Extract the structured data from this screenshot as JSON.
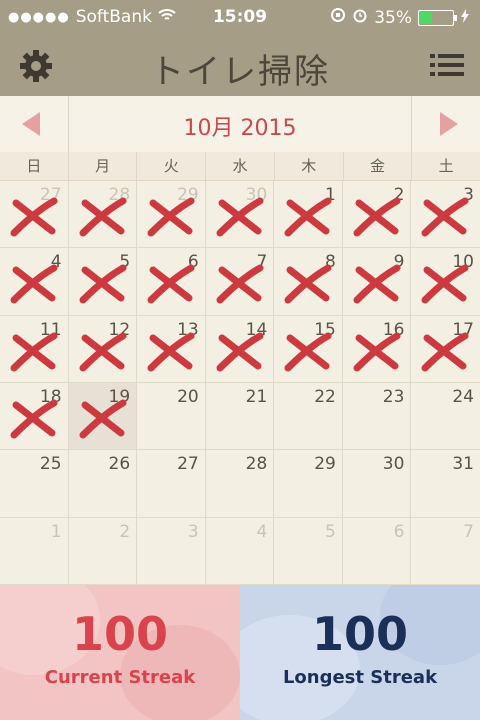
{
  "status": {
    "carrier": "SoftBank",
    "time": "15:09",
    "battery": "35%"
  },
  "nav": {
    "title": "トイレ掃除"
  },
  "month": {
    "label": "10月 2015"
  },
  "weekdays": [
    "日",
    "月",
    "火",
    "水",
    "木",
    "金",
    "土"
  ],
  "days": [
    {
      "n": "27",
      "other": true,
      "marked": true
    },
    {
      "n": "28",
      "other": true,
      "marked": true
    },
    {
      "n": "29",
      "other": true,
      "marked": true
    },
    {
      "n": "30",
      "other": true,
      "marked": true
    },
    {
      "n": "1",
      "marked": true
    },
    {
      "n": "2",
      "marked": true
    },
    {
      "n": "3",
      "marked": true
    },
    {
      "n": "4",
      "marked": true
    },
    {
      "n": "5",
      "marked": true
    },
    {
      "n": "6",
      "marked": true
    },
    {
      "n": "7",
      "marked": true
    },
    {
      "n": "8",
      "marked": true
    },
    {
      "n": "9",
      "marked": true
    },
    {
      "n": "10",
      "marked": true
    },
    {
      "n": "11",
      "marked": true
    },
    {
      "n": "12",
      "marked": true
    },
    {
      "n": "13",
      "marked": true
    },
    {
      "n": "14",
      "marked": true
    },
    {
      "n": "15",
      "marked": true
    },
    {
      "n": "16",
      "marked": true
    },
    {
      "n": "17",
      "marked": true
    },
    {
      "n": "18",
      "marked": true
    },
    {
      "n": "19",
      "marked": true,
      "today": true
    },
    {
      "n": "20"
    },
    {
      "n": "21"
    },
    {
      "n": "22"
    },
    {
      "n": "23"
    },
    {
      "n": "24"
    },
    {
      "n": "25"
    },
    {
      "n": "26"
    },
    {
      "n": "27"
    },
    {
      "n": "28"
    },
    {
      "n": "29"
    },
    {
      "n": "30"
    },
    {
      "n": "31"
    },
    {
      "n": "1",
      "other": true
    },
    {
      "n": "2",
      "other": true
    },
    {
      "n": "3",
      "other": true
    },
    {
      "n": "4",
      "other": true
    },
    {
      "n": "5",
      "other": true
    },
    {
      "n": "6",
      "other": true
    },
    {
      "n": "7",
      "other": true
    }
  ],
  "streaks": {
    "current_value": "100",
    "current_label": "Current Streak",
    "longest_value": "100",
    "longest_label": "Longest Streak"
  },
  "colors": {
    "mark": "#cc3a3f",
    "nav": "#a59d85",
    "accent": "#c9484b"
  },
  "icons": {
    "settings": "gear-icon",
    "menu": "list-menu-icon",
    "prev": "triangle-left-icon",
    "next": "triangle-right-icon",
    "mark": "cross-mark-icon"
  }
}
